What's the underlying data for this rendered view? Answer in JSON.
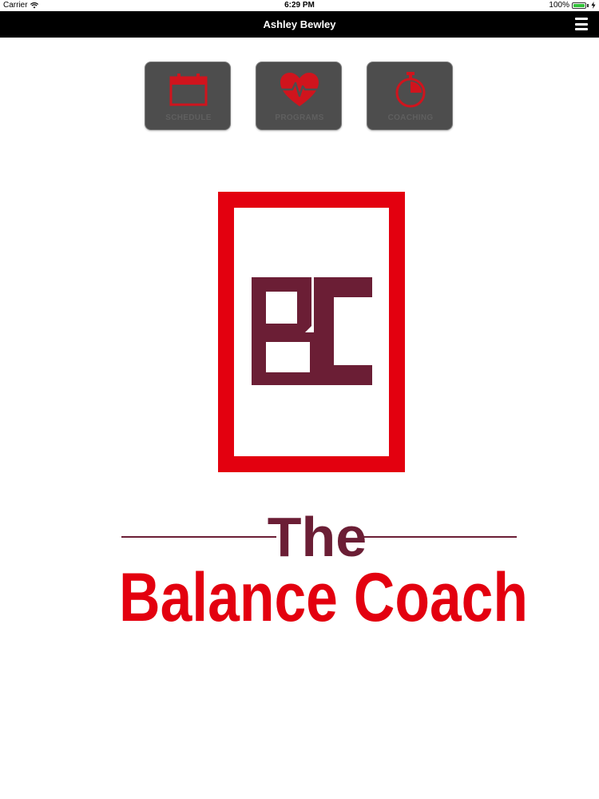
{
  "status_bar": {
    "carrier": "Carrier",
    "time": "6:29 PM",
    "battery_percent": "100%",
    "icons": [
      "wifi-icon",
      "battery-icon",
      "charging-icon"
    ]
  },
  "nav": {
    "title": "Ashley Bewley",
    "menu_icon": "hamburger-menu-icon"
  },
  "tiles": [
    {
      "label": "SCHEDULE",
      "icon": "calendar-icon"
    },
    {
      "label": "PROGRAMS",
      "icon": "heart-pulse-icon"
    },
    {
      "label": "COACHING",
      "icon": "stopwatch-icon"
    }
  ],
  "logo": {
    "monogram": "BC",
    "line1": "The",
    "line2": "Balance Coach"
  },
  "colors": {
    "red": "#e3000f",
    "maroon": "#6b1e35",
    "tile_bg": "#4d4d4d",
    "nav_bg": "#000000"
  }
}
